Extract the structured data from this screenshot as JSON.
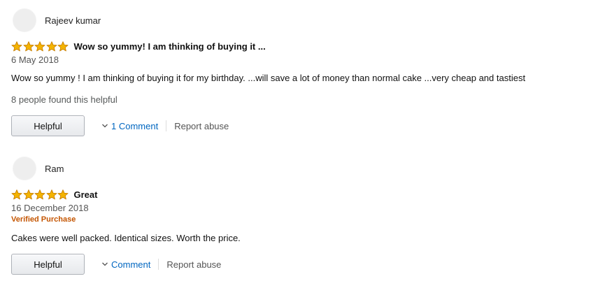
{
  "colors": {
    "star": "#f4b400",
    "star_outline": "#c97f00",
    "link": "#0066c0",
    "verified": "#c45500"
  },
  "reviews": [
    {
      "reviewer": "Rajeev kumar",
      "rating": 5,
      "max_rating": 5,
      "title": "Wow so yummy! I am thinking of buying it ...",
      "date": "6 May 2018",
      "body": "Wow so yummy ! I am thinking of buying it for my birthday. ...will save a lot of money than normal cake ...very cheap and tastiest",
      "helpful_count": "8 people found this helpful",
      "helpful_label": "Helpful",
      "comment_label": "1 Comment",
      "report_label": "Report abuse"
    },
    {
      "reviewer": "Ram",
      "rating": 5,
      "max_rating": 5,
      "title": "Great",
      "date": "16 December 2018",
      "verified_label": "Verified Purchase",
      "body": "Cakes were well packed. Identical sizes. Worth the price.",
      "helpful_label": "Helpful",
      "comment_label": "Comment",
      "report_label": "Report abuse"
    }
  ]
}
